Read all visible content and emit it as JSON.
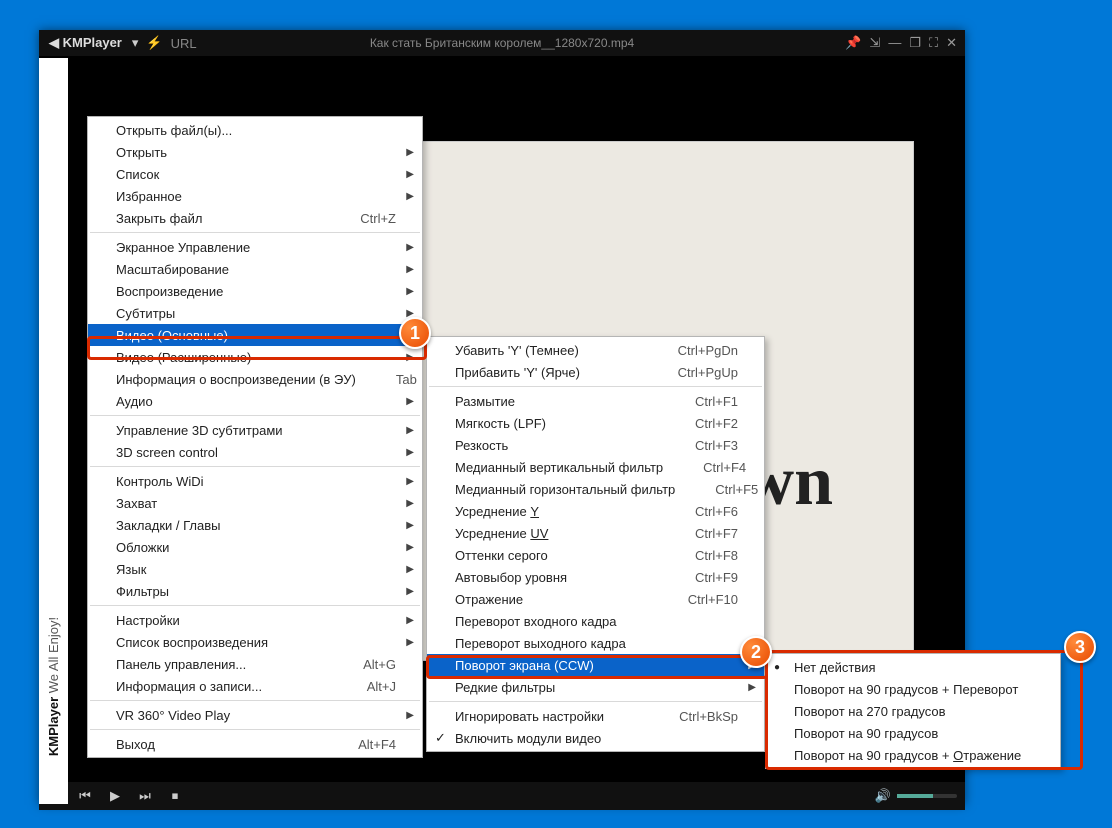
{
  "titlebar": {
    "logo": "◀ KMPlayer",
    "dropdown": "▾",
    "bolt": "⚡",
    "url": "URL",
    "title": "Как стать Британским королем__1280x720.mp4"
  },
  "sidebar": {
    "brand": "KMPlayer",
    "slogan": " We All Enjoy!"
  },
  "paper": {
    "text": "wn"
  },
  "volicon": "🔊",
  "badges": {
    "b1": "1",
    "b2": "2",
    "b3": "3"
  },
  "menu1": [
    {
      "t": "item",
      "label": "Открыть файл(ы)..."
    },
    {
      "t": "item",
      "label": "Открыть",
      "sub": true
    },
    {
      "t": "item",
      "label": "Список",
      "sub": true
    },
    {
      "t": "item",
      "label": "Избранное",
      "sub": true
    },
    {
      "t": "item",
      "label": "Закрыть файл",
      "sc": "Ctrl+Z"
    },
    {
      "t": "sep"
    },
    {
      "t": "item",
      "label": "Экранное Управление",
      "sub": true
    },
    {
      "t": "item",
      "label": "Масштабирование",
      "sub": true
    },
    {
      "t": "item",
      "label": "Воспроизведение",
      "sub": true
    },
    {
      "t": "item",
      "label": "Субтитры",
      "sub": true
    },
    {
      "t": "item",
      "label": "Видео (Основные)",
      "sub": true,
      "hl": true
    },
    {
      "t": "item",
      "label": "Видео (Расширенные)",
      "sub": true
    },
    {
      "t": "item",
      "label": "Информация о воспроизведении (в ЭУ)",
      "sc": "Tab"
    },
    {
      "t": "item",
      "label": "Аудио",
      "sub": true
    },
    {
      "t": "sep"
    },
    {
      "t": "item",
      "label": "Управление 3D субтитрами",
      "sub": true
    },
    {
      "t": "item",
      "label": "3D screen control",
      "sub": true
    },
    {
      "t": "sep"
    },
    {
      "t": "item",
      "label": "Контроль WiDi",
      "sub": true
    },
    {
      "t": "item",
      "label": "Захват",
      "sub": true
    },
    {
      "t": "item",
      "label": "Закладки / Главы",
      "sub": true
    },
    {
      "t": "item",
      "label": "Обложки",
      "sub": true
    },
    {
      "t": "item",
      "label": "Язык",
      "sub": true
    },
    {
      "t": "item",
      "label": "Фильтры",
      "sub": true
    },
    {
      "t": "sep"
    },
    {
      "t": "item",
      "label": "Настройки",
      "sub": true
    },
    {
      "t": "item",
      "label": "Список воспроизведения",
      "sub": true
    },
    {
      "t": "item",
      "label": "Панель управления...",
      "sc": "Alt+G"
    },
    {
      "t": "item",
      "label": "Информация о записи...",
      "sc": "Alt+J"
    },
    {
      "t": "sep"
    },
    {
      "t": "item",
      "label": "VR 360° Video Play",
      "sub": true
    },
    {
      "t": "sep"
    },
    {
      "t": "item",
      "label": "Выход",
      "sc": "Alt+F4"
    }
  ],
  "menu2": [
    {
      "t": "item",
      "label": "Убавить 'Y' (Темнее)",
      "sc": "Ctrl+PgDn"
    },
    {
      "t": "item",
      "label": "Прибавить 'Y' (Ярче)",
      "sc": "Ctrl+PgUp"
    },
    {
      "t": "sep"
    },
    {
      "t": "item",
      "label": "Размытие",
      "sc": "Ctrl+F1"
    },
    {
      "t": "item",
      "label": "Мягкость (LPF)",
      "sc": "Ctrl+F2"
    },
    {
      "t": "item",
      "label": "Резкость",
      "sc": "Ctrl+F3"
    },
    {
      "t": "item",
      "label": "Медианный вертикальный фильтр",
      "sc": "Ctrl+F4"
    },
    {
      "t": "item",
      "label": "Медианный горизонтальный фильтр",
      "sc": "Ctrl+F5"
    },
    {
      "t": "item",
      "label": "Усреднение  Y",
      "u": "Y",
      "sc": "Ctrl+F6"
    },
    {
      "t": "item",
      "label": "Усреднение  UV",
      "u": "UV",
      "sc": "Ctrl+F7"
    },
    {
      "t": "item",
      "label": "Оттенки серого",
      "sc": "Ctrl+F8"
    },
    {
      "t": "item",
      "label": "Автовыбор уровня",
      "sc": "Ctrl+F9"
    },
    {
      "t": "item",
      "label": "Отражение",
      "sc": "Ctrl+F10"
    },
    {
      "t": "item",
      "label": "Переворот входного кадра"
    },
    {
      "t": "item",
      "label": "Переворот выходного кадра"
    },
    {
      "t": "item",
      "label": "Поворот экрана (CCW)",
      "sub": true,
      "hl": true
    },
    {
      "t": "item",
      "label": "Редкие фильтры",
      "sub": true
    },
    {
      "t": "sep"
    },
    {
      "t": "item",
      "label": "Игнорировать настройки",
      "sc": "Ctrl+BkSp"
    },
    {
      "t": "item",
      "label": "Включить модули видео",
      "chk": true
    }
  ],
  "menu3": [
    {
      "t": "item",
      "label": "Нет действия",
      "radio": true
    },
    {
      "t": "item",
      "label": "Поворот на 90 градусов + Переворот"
    },
    {
      "t": "item",
      "label": "Поворот на 270 градусов"
    },
    {
      "t": "item",
      "label": "Поворот на 90 градусов"
    },
    {
      "t": "item",
      "label": "Поворот на 90 градусов + Отражение",
      "u": "О"
    }
  ]
}
